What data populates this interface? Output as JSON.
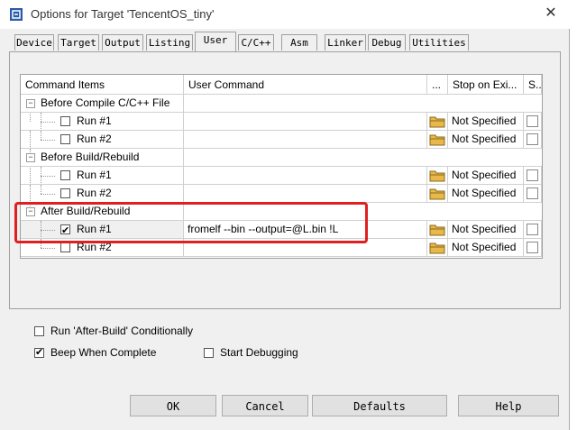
{
  "window": {
    "title": "Options for Target 'TencentOS_tiny'",
    "close_glyph": "✕"
  },
  "tabs": [
    {
      "label": "Device"
    },
    {
      "label": "Target"
    },
    {
      "label": "Output"
    },
    {
      "label": "Listing"
    },
    {
      "label": "User",
      "active": true
    },
    {
      "label": "C/C++"
    },
    {
      "label": "Asm"
    },
    {
      "label": "Linker"
    },
    {
      "label": "Debug"
    },
    {
      "label": "Utilities"
    }
  ],
  "grid": {
    "headers": {
      "items": "Command Items",
      "command": "User Command",
      "dots": "...",
      "stop": "Stop on Exi...",
      "s": "S..."
    },
    "groups": [
      {
        "label": "Before Compile C/C++ File",
        "runs": [
          {
            "label": "Run #1",
            "checked": false,
            "command": "",
            "stop": "Not Specified"
          },
          {
            "label": "Run #2",
            "checked": false,
            "command": "",
            "stop": "Not Specified"
          }
        ]
      },
      {
        "label": "Before Build/Rebuild",
        "runs": [
          {
            "label": "Run #1",
            "checked": false,
            "command": "",
            "stop": "Not Specified"
          },
          {
            "label": "Run #2",
            "checked": false,
            "command": "",
            "stop": "Not Specified"
          }
        ]
      },
      {
        "label": "After Build/Rebuild",
        "runs": [
          {
            "label": "Run #1",
            "checked": true,
            "command": "fromelf --bin --output=@L.bin !L",
            "stop": "Not Specified"
          },
          {
            "label": "Run #2",
            "checked": false,
            "command": "",
            "stop": "Not Specified"
          }
        ]
      }
    ]
  },
  "options": {
    "run_after_build": {
      "label": "Run 'After-Build' Conditionally",
      "checked": false
    },
    "beep": {
      "label": "Beep When Complete",
      "checked": true
    },
    "start_debugging": {
      "label": "Start Debugging",
      "checked": false
    }
  },
  "buttons": {
    "ok": "OK",
    "cancel": "Cancel",
    "defaults": "Defaults",
    "help": "Help"
  },
  "colors": {
    "highlight": "#e02020",
    "folder": "#e8b84a"
  }
}
